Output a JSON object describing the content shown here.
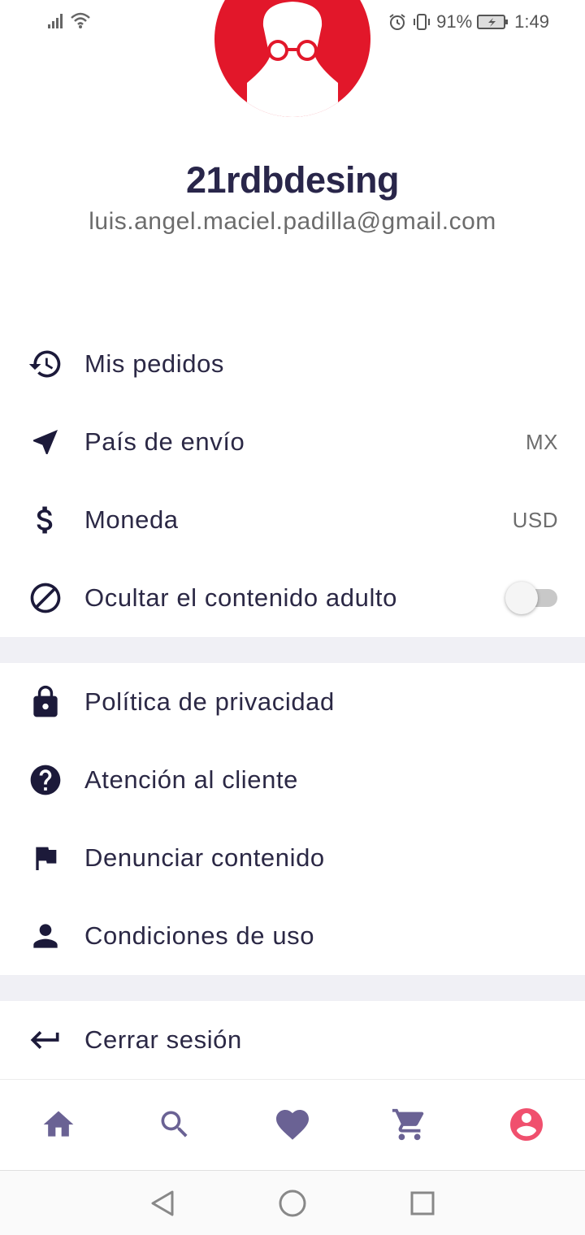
{
  "status_bar": {
    "battery": "91%",
    "time": "1:49",
    "icons": [
      "signal-icon",
      "wifi-icon",
      "alarm-icon",
      "vibrate-icon",
      "battery-charging-icon"
    ]
  },
  "profile": {
    "username": "21rdbdesing",
    "email": "luis.angel.maciel.padilla@gmail.com"
  },
  "menu_group_1": [
    {
      "icon": "history-icon",
      "label": "Mis pedidos"
    },
    {
      "icon": "navigation-arrow-icon",
      "label": "País de envío",
      "value": "MX"
    },
    {
      "icon": "dollar-icon",
      "label": "Moneda",
      "value": "USD"
    },
    {
      "icon": "block-icon",
      "label": "Ocultar el contenido adulto",
      "toggle": false
    }
  ],
  "menu_group_2": [
    {
      "icon": "lock-icon",
      "label": "Política de privacidad"
    },
    {
      "icon": "help-circle-icon",
      "label": "Atención al cliente"
    },
    {
      "icon": "flag-icon",
      "label": "Denunciar contenido"
    },
    {
      "icon": "person-icon",
      "label": "Condiciones de uso"
    }
  ],
  "menu_group_3": [
    {
      "icon": "logout-arrow-icon",
      "label": "Cerrar sesión"
    }
  ],
  "bottom_nav": {
    "items": [
      "home-icon",
      "search-icon",
      "heart-icon",
      "cart-icon",
      "account-icon"
    ],
    "active": "account-icon",
    "color": "#6a6294",
    "active_color": "#f0506e"
  },
  "colors": {
    "avatar_bg": "#e2172a",
    "divider": "#f0f0f5",
    "text": "#2b2845"
  }
}
